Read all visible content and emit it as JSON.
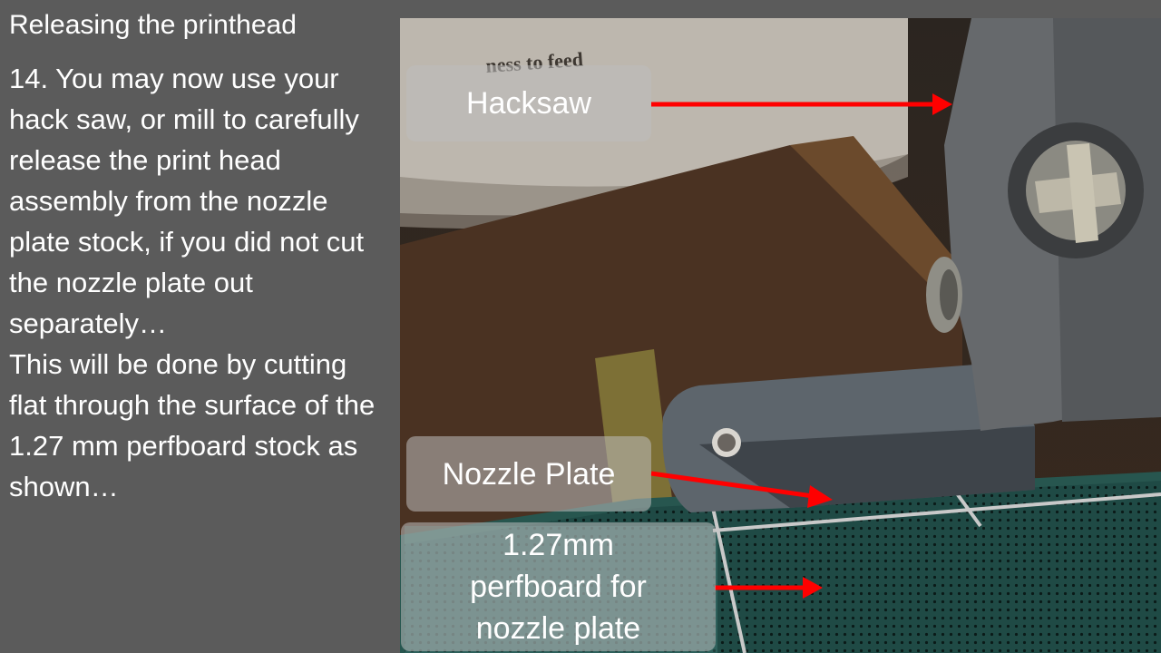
{
  "slide": {
    "title": "Releasing the printhead",
    "paragraph_1": "14. You may now use your hack saw, or mill to carefully release the print head assembly from the nozzle plate stock, if you did not cut the nozzle plate out separately…",
    "paragraph_2": "This will be done by cutting flat through the surface of the 1.27 mm perfboard stock as shown…"
  },
  "photo": {
    "mug_text": "ness to feed",
    "labels": {
      "hacksaw": "Hacksaw",
      "nozzle_plate": "Nozzle Plate",
      "perfboard_line1": "1.27mm",
      "perfboard_line2": "perfboard for",
      "perfboard_line3": "nozzle plate"
    }
  },
  "colors": {
    "background": "#5b5b5b",
    "text": "#ffffff",
    "arrow": "#ff0000",
    "label_fill": "rgba(190,190,190,0.55)"
  }
}
